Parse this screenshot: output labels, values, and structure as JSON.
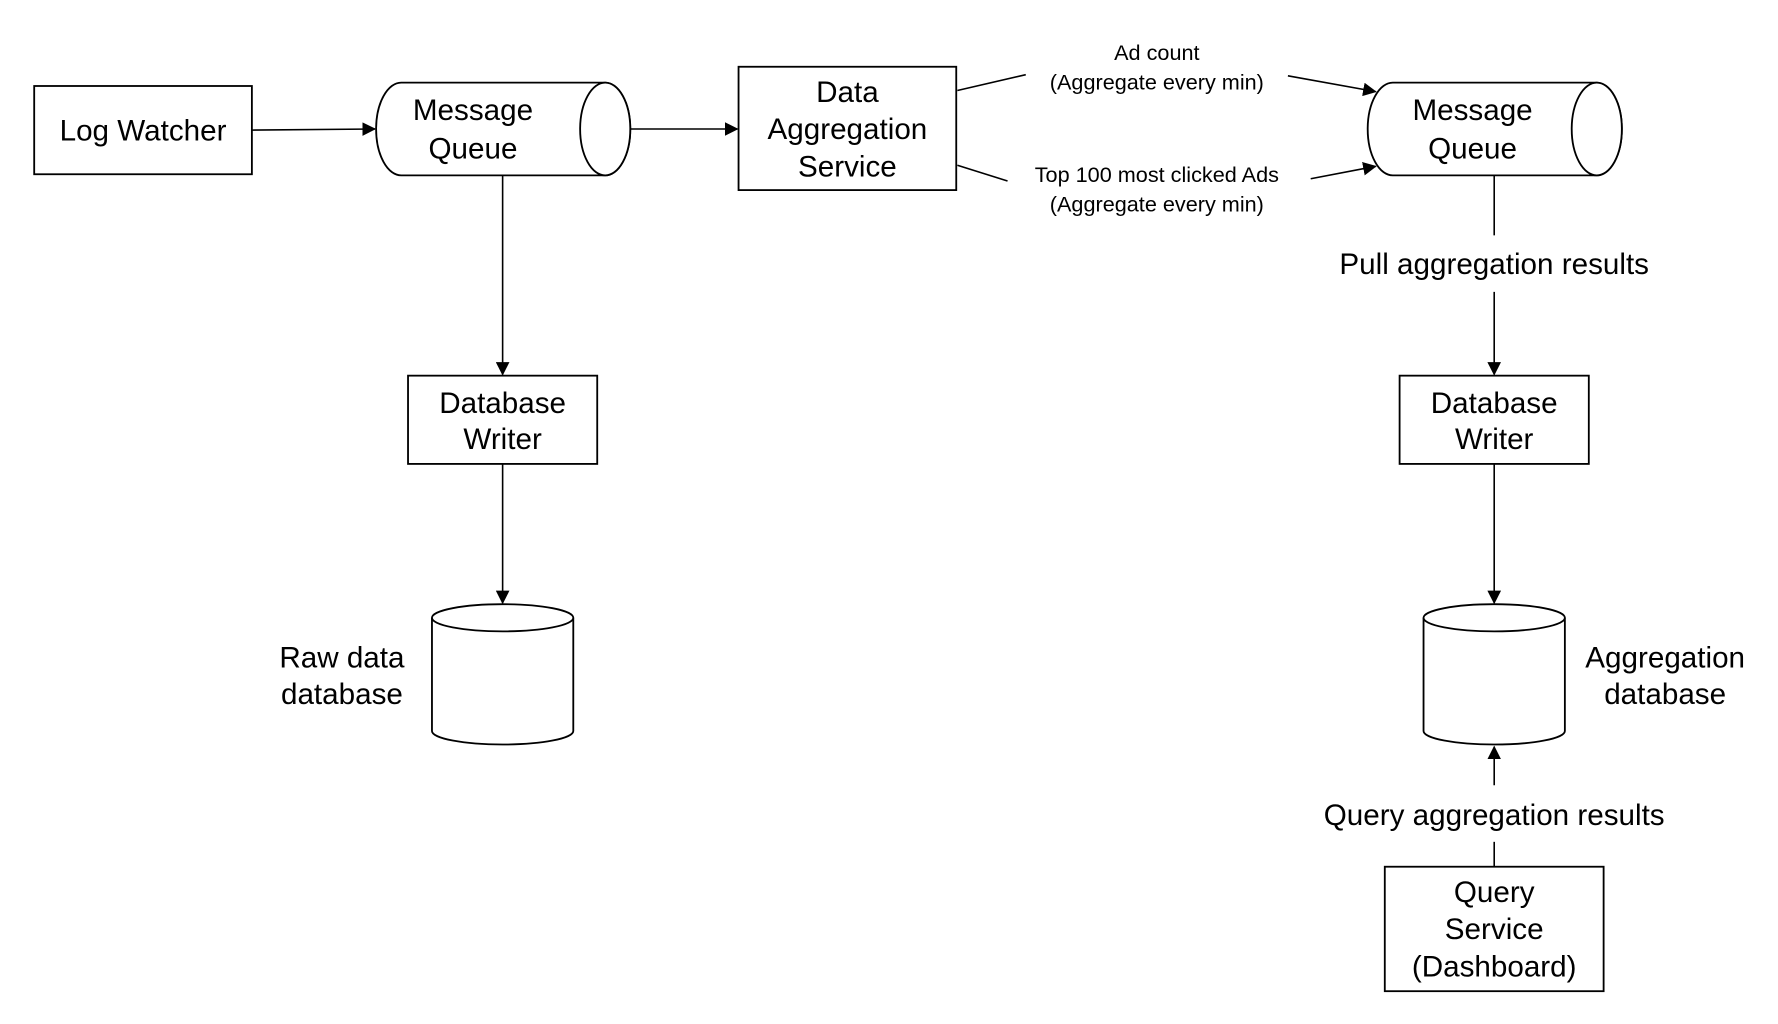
{
  "diagram": {
    "nodes": {
      "log_watcher": {
        "label": [
          "Log Watcher"
        ],
        "shape": "box"
      },
      "mq_left": {
        "label": [
          "Message",
          "Queue"
        ],
        "shape": "queue"
      },
      "data_agg": {
        "label": [
          "Data",
          "Aggregation",
          "Service"
        ],
        "shape": "box"
      },
      "mq_right": {
        "label": [
          "Message",
          "Queue"
        ],
        "shape": "queue"
      },
      "dbw_left": {
        "label": [
          "Database",
          "Writer"
        ],
        "shape": "box"
      },
      "dbw_right": {
        "label": [
          "Database",
          "Writer"
        ],
        "shape": "box"
      },
      "raw_db": {
        "label": [
          "Raw data",
          "database"
        ],
        "shape": "database"
      },
      "agg_db": {
        "label": [
          "Aggregation",
          "database"
        ],
        "shape": "database"
      },
      "query_service": {
        "label": [
          "Query",
          "Service",
          "(Dashboard)"
        ],
        "shape": "box"
      }
    },
    "edges": {
      "ad_count": {
        "label": [
          "Ad count",
          "(Aggregate every min)"
        ],
        "from": "Data Aggregation Service",
        "to": "Message Queue"
      },
      "top_100": {
        "label": [
          "Top 100 most clicked Ads",
          "(Aggregate every min)"
        ],
        "from": "Data Aggregation Service",
        "to": "Message Queue"
      },
      "pull": {
        "label": "Pull aggregation results",
        "from": "Message Queue",
        "to": "Database Writer"
      },
      "query": {
        "label": "Query aggregation results",
        "from": "Query Service (Dashboard)",
        "to": "Aggregation database"
      }
    },
    "colors": {
      "stroke": "#000000",
      "fill": "#ffffff",
      "text": "#000000"
    }
  }
}
